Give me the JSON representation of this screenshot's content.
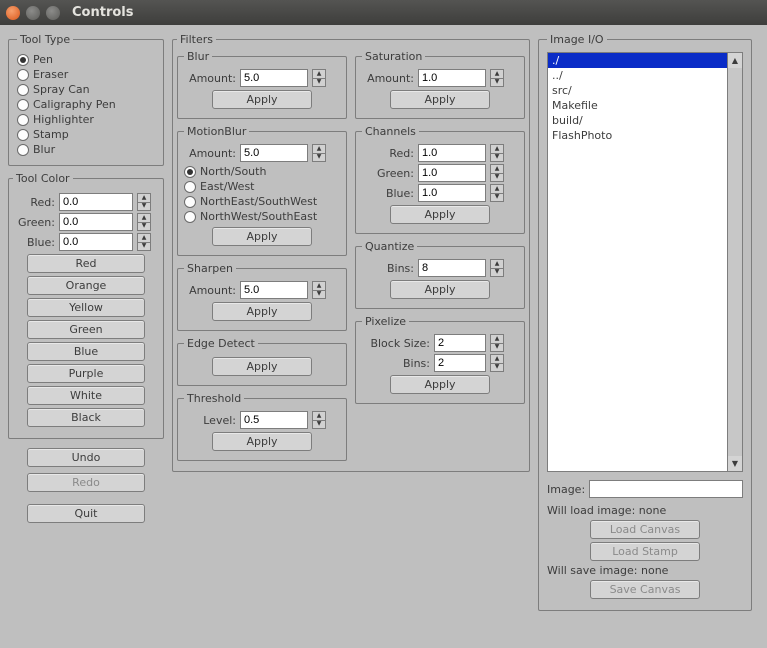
{
  "window": {
    "title": "Controls"
  },
  "tool_type": {
    "legend": "Tool Type",
    "options": [
      "Pen",
      "Eraser",
      "Spray Can",
      "Caligraphy Pen",
      "Highlighter",
      "Stamp",
      "Blur"
    ],
    "selected": "Pen"
  },
  "tool_color": {
    "legend": "Tool Color",
    "channels": {
      "red": {
        "label": "Red:",
        "value": "0.0"
      },
      "green": {
        "label": "Green:",
        "value": "0.0"
      },
      "blue": {
        "label": "Blue:",
        "value": "0.0"
      }
    },
    "presets": [
      "Red",
      "Orange",
      "Yellow",
      "Green",
      "Blue",
      "Purple",
      "White",
      "Black"
    ]
  },
  "actions": {
    "undo": "Undo",
    "redo": "Redo",
    "quit": "Quit"
  },
  "filters": {
    "legend": "Filters",
    "blur": {
      "legend": "Blur",
      "amount_label": "Amount:",
      "amount": "5.0",
      "apply": "Apply"
    },
    "motionblur": {
      "legend": "MotionBlur",
      "amount_label": "Amount:",
      "amount": "5.0",
      "dirs": [
        "North/South",
        "East/West",
        "NorthEast/SouthWest",
        "NorthWest/SouthEast"
      ],
      "selected_dir": "North/South",
      "apply": "Apply"
    },
    "sharpen": {
      "legend": "Sharpen",
      "amount_label": "Amount:",
      "amount": "5.0",
      "apply": "Apply"
    },
    "edgedetect": {
      "legend": "Edge Detect",
      "apply": "Apply"
    },
    "threshold": {
      "legend": "Threshold",
      "level_label": "Level:",
      "level": "0.5",
      "apply": "Apply"
    },
    "saturation": {
      "legend": "Saturation",
      "amount_label": "Amount:",
      "amount": "1.0",
      "apply": "Apply"
    },
    "channels": {
      "legend": "Channels",
      "red": {
        "label": "Red:",
        "value": "1.0"
      },
      "green": {
        "label": "Green:",
        "value": "1.0"
      },
      "blue": {
        "label": "Blue:",
        "value": "1.0"
      },
      "apply": "Apply"
    },
    "quantize": {
      "legend": "Quantize",
      "bins_label": "Bins:",
      "bins": "8",
      "apply": "Apply"
    },
    "pixelize": {
      "legend": "Pixelize",
      "block_label": "Block Size:",
      "block": "2",
      "bins_label": "Bins:",
      "bins": "2",
      "apply": "Apply"
    }
  },
  "image_io": {
    "legend": "Image I/O",
    "files": [
      "./",
      "../",
      "src/",
      "Makefile",
      "build/",
      "FlashPhoto"
    ],
    "selected_file": "./",
    "image_label": "Image:",
    "image_value": "",
    "load_status": "Will load image: none",
    "save_status": "Will save image: none",
    "load_canvas": "Load Canvas",
    "load_stamp": "Load Stamp",
    "save_canvas": "Save Canvas"
  }
}
